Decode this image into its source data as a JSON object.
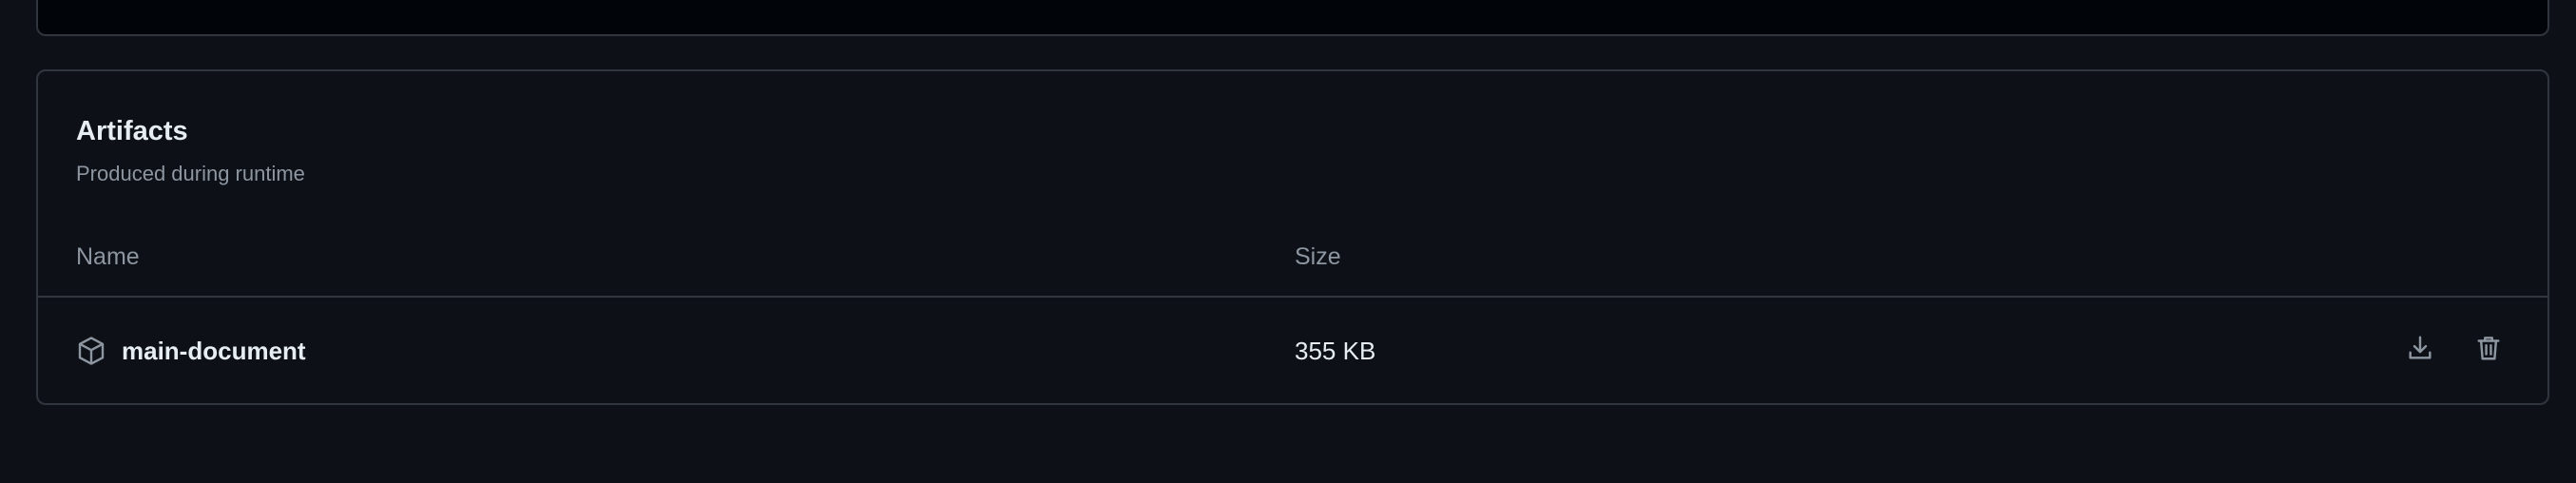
{
  "artifacts": {
    "title": "Artifacts",
    "subtitle": "Produced during runtime",
    "columns": {
      "name": "Name",
      "size": "Size"
    },
    "rows": [
      {
        "icon": "package-icon",
        "name": "main-document",
        "size": "355 KB",
        "actions": [
          "download-icon",
          "trash-icon"
        ]
      }
    ]
  },
  "colors": {
    "background": "#0d1117",
    "border": "#30363d",
    "text": "#e6edf3",
    "muted_text": "#8d96a0",
    "icon": "#8d96a0"
  }
}
